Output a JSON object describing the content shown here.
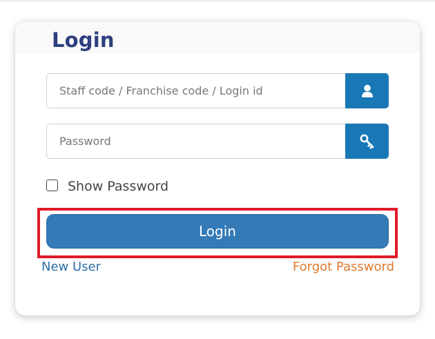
{
  "form": {
    "title": "Login",
    "username_placeholder": "Staff code / Franchise code / Login id",
    "username_value": "",
    "password_placeholder": "Password",
    "password_value": "",
    "show_password_label": "Show Password",
    "show_password_checked": false,
    "login_label": "Login",
    "new_user_label": "New User",
    "forgot_password_label": "Forgot Password"
  },
  "icons": {
    "username_addon": "user-icon",
    "password_addon": "key-icon"
  },
  "colors": {
    "title": "#2e3f7f",
    "addon_background": "#1878b5",
    "login_button": "#337ab7",
    "highlight_border": "#e01a28",
    "new_user_link": "#2f6ea8",
    "forgot_link": "#dd7a30"
  }
}
